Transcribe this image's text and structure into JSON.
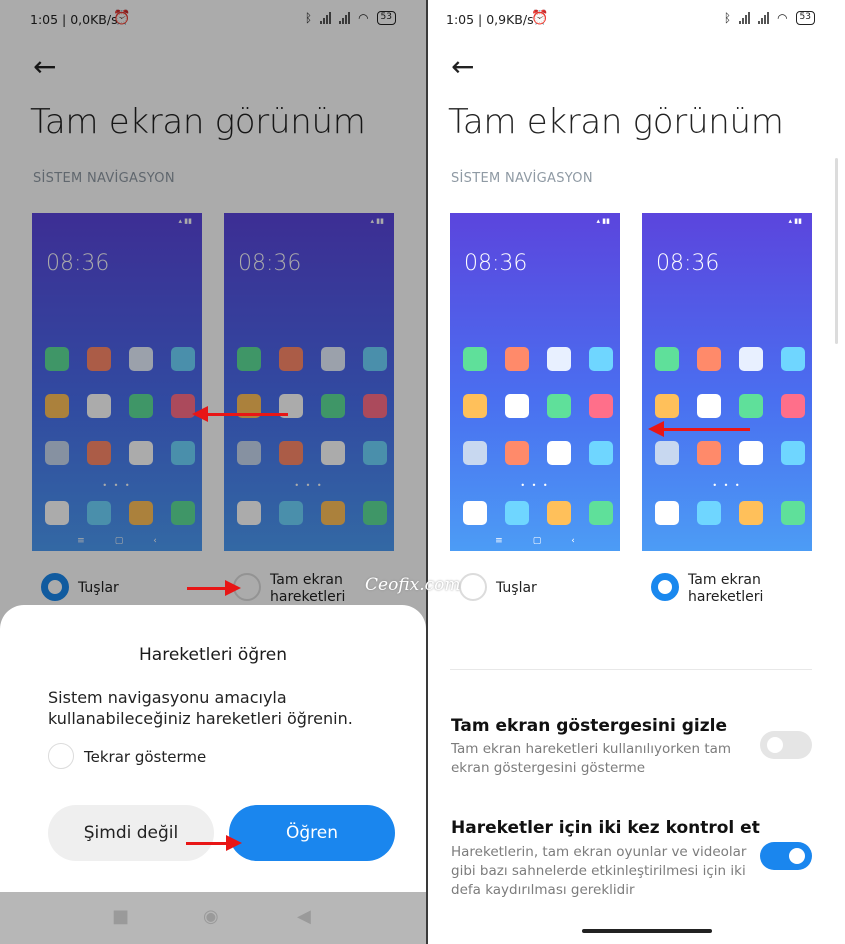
{
  "left_screen": {
    "status": {
      "time": "1:05 | 0,0KB/s",
      "battery": "53"
    },
    "page_title": "Tam ekran görünüm",
    "section_label": "SİSTEM NAVİGASYON",
    "preview_time": "08:36",
    "option_buttons": "Tuşlar",
    "option_fullscreen": "Tam ekran hareketleri",
    "dialog": {
      "title": "Hareketleri öğren",
      "description": "Sistem navigasyonu amacıyla kullanabileceğiniz hareketleri öğrenin.",
      "checkbox_label": "Tekrar gösterme",
      "cancel_label": "Şimdi değil",
      "confirm_label": "Öğren"
    }
  },
  "right_screen": {
    "status": {
      "time": "1:05 | 0,9KB/s",
      "battery": "53"
    },
    "page_title": "Tam ekran görünüm",
    "section_label": "SİSTEM NAVİGASYON",
    "preview_time": "08:36",
    "option_buttons": "Tuşlar",
    "option_fullscreen": "Tam ekran hareketleri",
    "settings": [
      {
        "title": "Tam ekran göstergesini gizle",
        "description": "Tam ekran hareketleri kullanılıyorken tam ekran göstergesini gösterme",
        "enabled": false
      },
      {
        "title": "Hareketler için iki kez kontrol et",
        "description": "Hareketlerin, tam ekran oyunlar ve videolar gibi bazı sahnelerde etkinleştirilmesi için iki defa kaydırılması gereklidir",
        "enabled": true
      }
    ]
  },
  "watermark": "Ceofix.com",
  "icons": {
    "back": "arrow-left-icon",
    "alarm": "alarm-clock-icon",
    "bluetooth": "bluetooth-icon",
    "signal": "cell-signal-icon",
    "wifi": "wifi-icon"
  },
  "colors": {
    "accent": "#1a86ee",
    "annotation_arrow": "#e81616",
    "app_icons": [
      "#5fe09a",
      "#ff8a6a",
      "#e8f0ff",
      "#6fd6ff",
      "#ffc05a",
      "#ffffff",
      "#5fe09a",
      "#ff6f8a",
      "#c8d8f0",
      "#ff8a6a",
      "#ffffff",
      "#6fd6ff"
    ],
    "dock_icons": [
      "#ffffff",
      "#6fd6ff",
      "#ffc05a",
      "#5fe09a"
    ]
  }
}
